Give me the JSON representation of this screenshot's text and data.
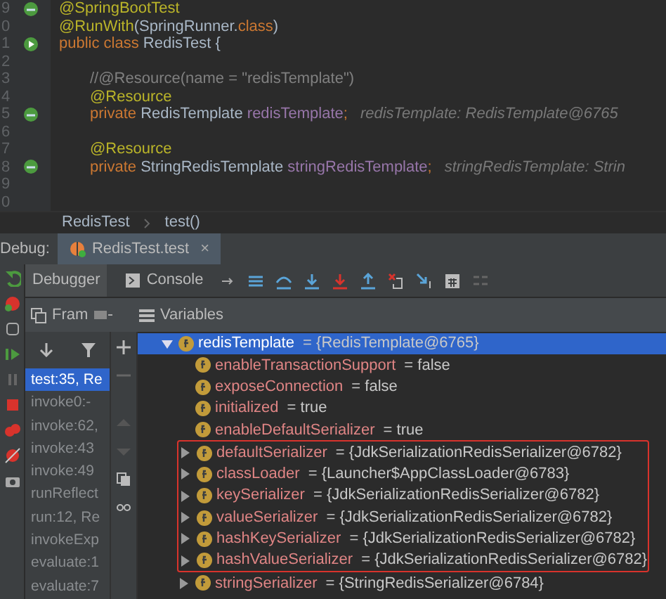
{
  "editor": {
    "lines": [
      {
        "number": "9",
        "kind": "bean",
        "tokens": [
          {
            "text": "@SpringBootTest",
            "kind": "annotation"
          }
        ]
      },
      {
        "number": "0",
        "kind": "plain",
        "tokens": [
          {
            "text": "@RunWith",
            "kind": "annotation"
          },
          {
            "text": "(SpringRunner.",
            "kind": "plain"
          },
          {
            "text": "class",
            "kind": "keyword"
          },
          {
            "text": ")",
            "kind": "plain"
          }
        ]
      },
      {
        "number": "1",
        "kind": "run",
        "tokens": [
          {
            "text": "public class ",
            "kind": "keyword"
          },
          {
            "text": "RedisTest {",
            "kind": "plain"
          }
        ],
        "children": [
          {
            "number": "2",
            "kind": "plain"
          },
          {
            "number": "3",
            "kind": "plain",
            "tokens": [
              {
                "text": "//@Resource(name = \"redisTemplate\")",
                "kind": "comment"
              }
            ]
          },
          {
            "number": "4",
            "kind": "plain",
            "tokens": [
              {
                "text": "@Resource",
                "kind": "annotation"
              }
            ]
          },
          {
            "number": "5",
            "kind": "bean",
            "tokens": [
              {
                "text": "private ",
                "kind": "keyword"
              },
              {
                "text": "RedisTemplate ",
                "kind": "plain"
              },
              {
                "text": "redisTemplate",
                "kind": "field"
              },
              {
                "text": ";",
                "kind": "keyword"
              },
              {
                "text": "redisTemplate: RedisTemplate@6765",
                "kind": "hint"
              }
            ]
          },
          {
            "number": "6",
            "kind": "plain"
          },
          {
            "number": "7",
            "kind": "plain",
            "tokens": [
              {
                "text": "@Resource",
                "kind": "annotation"
              }
            ]
          },
          {
            "number": "8",
            "kind": "bean",
            "tokens": [
              {
                "text": "private ",
                "kind": "keyword"
              },
              {
                "text": "StringRedisTemplate ",
                "kind": "plain"
              },
              {
                "text": "stringRedisTemplate",
                "kind": "field"
              },
              {
                "text": ";",
                "kind": "keyword"
              },
              {
                "text": "stringRedisTemplate: Strin",
                "kind": "hint"
              }
            ]
          },
          {
            "number": "9",
            "kind": "plain"
          },
          {
            "number": "0",
            "kind": "plain"
          }
        ]
      }
    ]
  },
  "breadcrumb": [
    "RedisTest",
    "test()"
  ],
  "debug": {
    "label": "Debug:",
    "tabs": [
      {
        "title": "RedisTest.test",
        "close": "×",
        "selected": true
      }
    ],
    "subtabs": [
      {
        "title": "Debugger",
        "selected": true
      },
      {
        "title": "Console",
        "selected": false
      }
    ],
    "frames_header": "Fram",
    "variables_header": "Variables",
    "frames": [
      {
        "text": "test:35, Re",
        "selected": true
      },
      {
        "text": "invoke0:-",
        "selected": false
      },
      {
        "text": "invoke:62,",
        "selected": false
      },
      {
        "text": "invoke:43",
        "selected": false
      },
      {
        "text": "invoke:49",
        "selected": false
      },
      {
        "text": "runReflect",
        "selected": false
      },
      {
        "text": "run:12, Re",
        "selected": false
      },
      {
        "text": "invokeExp",
        "selected": false
      },
      {
        "text": "evaluate:1",
        "selected": false
      },
      {
        "text": "evaluate:7",
        "selected": false
      }
    ],
    "variables": [
      {
        "name": "redisTemplate",
        "value": " = {RedisTemplate@6765}",
        "expanded": true,
        "selected": true,
        "children": [
          {
            "name": "enableTransactionSupport",
            "value": " = false",
            "selected": false,
            "boxed": false
          },
          {
            "name": "exposeConnection",
            "value": " = false",
            "selected": false,
            "boxed": false
          },
          {
            "name": "initialized",
            "value": " = true",
            "selected": false,
            "boxed": false
          },
          {
            "name": "enableDefaultSerializer",
            "value": " = true",
            "selected": false,
            "boxed": false
          },
          {
            "name": "defaultSerializer",
            "value": " = {JdkSerializationRedisSerializer@6782}",
            "expanded": false,
            "selected": false,
            "boxed": true
          },
          {
            "name": "classLoader",
            "value": " = {Launcher$AppClassLoader@6783}",
            "expanded": false,
            "selected": false,
            "boxed": true
          },
          {
            "name": "keySerializer",
            "value": " = {JdkSerializationRedisSerializer@6782}",
            "expanded": false,
            "selected": false,
            "boxed": true
          },
          {
            "name": "valueSerializer",
            "value": " = {JdkSerializationRedisSerializer@6782}",
            "expanded": false,
            "selected": false,
            "boxed": true
          },
          {
            "name": "hashKeySerializer",
            "value": " = {JdkSerializationRedisSerializer@6782}",
            "expanded": false,
            "selected": false,
            "boxed": true
          },
          {
            "name": "hashValueSerializer",
            "value": " = {JdkSerializationRedisSerializer@6782}",
            "expanded": false,
            "selected": false,
            "boxed": true
          },
          {
            "name": "stringSerializer",
            "value": " = {StringRedisSerializer@6784}",
            "expanded": false,
            "selected": false,
            "boxed": false
          }
        ]
      }
    ]
  }
}
